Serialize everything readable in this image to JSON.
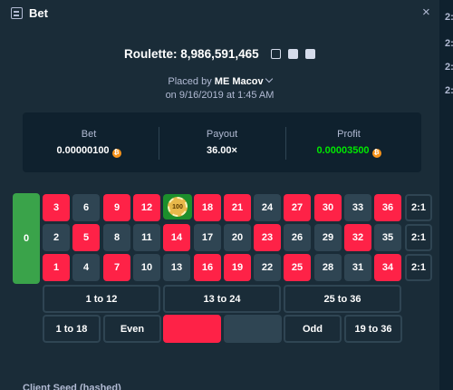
{
  "window": {
    "title": "Bet",
    "close_label": "×"
  },
  "game": {
    "name_line": "Roulette: 8,986,591,465"
  },
  "placed": {
    "prefix": "Placed by",
    "user": "ME Macov",
    "date": "on 9/16/2019 at 1:45 AM"
  },
  "stats": {
    "bet": {
      "label": "Bet",
      "value": "0.00000100"
    },
    "payout": {
      "label": "Payout",
      "value": "36.00×"
    },
    "profit": {
      "label": "Profit",
      "value": "0.00003500",
      "color": "#00e701"
    },
    "currency_icon": "bitcoin-icon"
  },
  "board": {
    "zero": "0",
    "rows": [
      [
        "3",
        "6",
        "9",
        "12",
        "15",
        "18",
        "21",
        "24",
        "27",
        "30",
        "33",
        "36"
      ],
      [
        "2",
        "5",
        "8",
        "11",
        "14",
        "17",
        "20",
        "23",
        "26",
        "29",
        "32",
        "35"
      ],
      [
        "1",
        "4",
        "7",
        "10",
        "13",
        "16",
        "19",
        "22",
        "25",
        "28",
        "31",
        "34"
      ]
    ],
    "column_bets": [
      "2:1",
      "2:1",
      "2:1"
    ],
    "dozens": [
      "1 to 12",
      "13 to 24",
      "25 to 36"
    ],
    "outside": [
      "1 to 18",
      "Even",
      "",
      "",
      "Odd",
      "19 to 36"
    ],
    "chip_value": "100",
    "chip_on": "15",
    "colors": {
      "red": "#fe2247",
      "black": "#2f4553",
      "green": "#3aa34a"
    }
  },
  "right_edge": [
    "2:",
    "2:",
    "2:",
    "2:"
  ],
  "seed": {
    "label": "Client Seed (hashed)"
  }
}
